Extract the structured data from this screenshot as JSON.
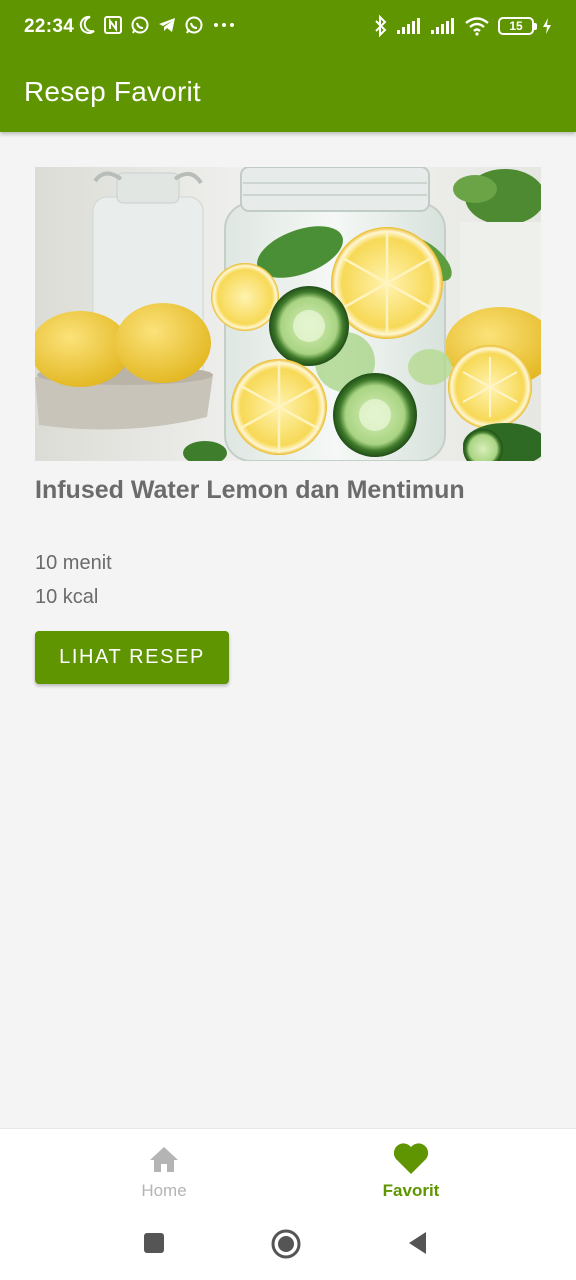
{
  "status_bar": {
    "time": "22:34",
    "battery": "15",
    "icons": [
      "moon-icon",
      "nfc-icon",
      "whatsapp-icon",
      "telegram-icon",
      "whatsapp-icon",
      "more-icon",
      "bluetooth-icon",
      "signal-icon",
      "signal-icon",
      "wifi-icon",
      "battery-icon",
      "charging-icon"
    ]
  },
  "app_bar": {
    "title": "Resep Favorit"
  },
  "recipe": {
    "title": "Infused Water Lemon dan Mentimun",
    "time": "10 menit",
    "kcal": "10 kcal",
    "button_label": "LIHAT RESEP"
  },
  "bottom_nav": {
    "items": [
      {
        "label": "Home",
        "icon": "home-icon",
        "active": false
      },
      {
        "label": "Favorit",
        "icon": "heart-icon",
        "active": true
      }
    ]
  },
  "system_nav": {
    "buttons": [
      "recents-button",
      "home-button",
      "back-button"
    ]
  },
  "colors": {
    "primary": "#5f9500",
    "background": "#f4f4f4",
    "text_secondary": "#6b6b6b",
    "nav_inactive": "#b4b4b4"
  }
}
